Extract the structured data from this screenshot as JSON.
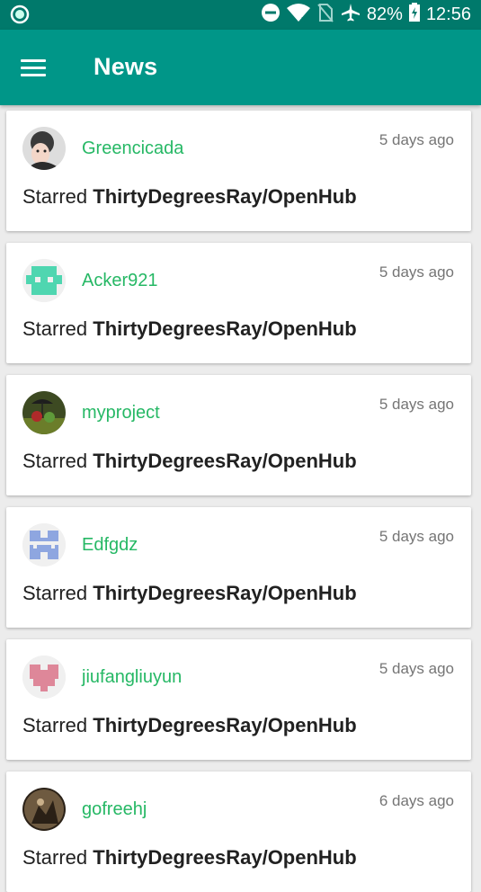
{
  "status_bar": {
    "battery": "82%",
    "time": "12:56",
    "icons": [
      "notification-dot-icon",
      "do-not-disturb-icon",
      "wifi-icon",
      "no-sim-icon",
      "airplane-icon",
      "battery-icon"
    ]
  },
  "app_bar": {
    "menu_icon": "hamburger-menu-icon",
    "title": "News"
  },
  "colors": {
    "status_bar": "#00796b",
    "app_bar": "#009688",
    "username": "#26b865",
    "background": "#ececec"
  },
  "events": [
    {
      "username": "Greencicada",
      "time": "5 days ago",
      "action": "Starred",
      "repo": "ThirtyDegreesRay/OpenHub"
    },
    {
      "username": "Acker921",
      "time": "5 days ago",
      "action": "Starred",
      "repo": "ThirtyDegreesRay/OpenHub"
    },
    {
      "username": "myproject",
      "time": "5 days ago",
      "action": "Starred",
      "repo": "ThirtyDegreesRay/OpenHub"
    },
    {
      "username": "Edfgdz",
      "time": "5 days ago",
      "action": "Starred",
      "repo": "ThirtyDegreesRay/OpenHub"
    },
    {
      "username": "jiufangliuyun",
      "time": "5 days ago",
      "action": "Starred",
      "repo": "ThirtyDegreesRay/OpenHub"
    },
    {
      "username": "gofreehj",
      "time": "6 days ago",
      "action": "Starred",
      "repo": "ThirtyDegreesRay/OpenHub"
    }
  ]
}
